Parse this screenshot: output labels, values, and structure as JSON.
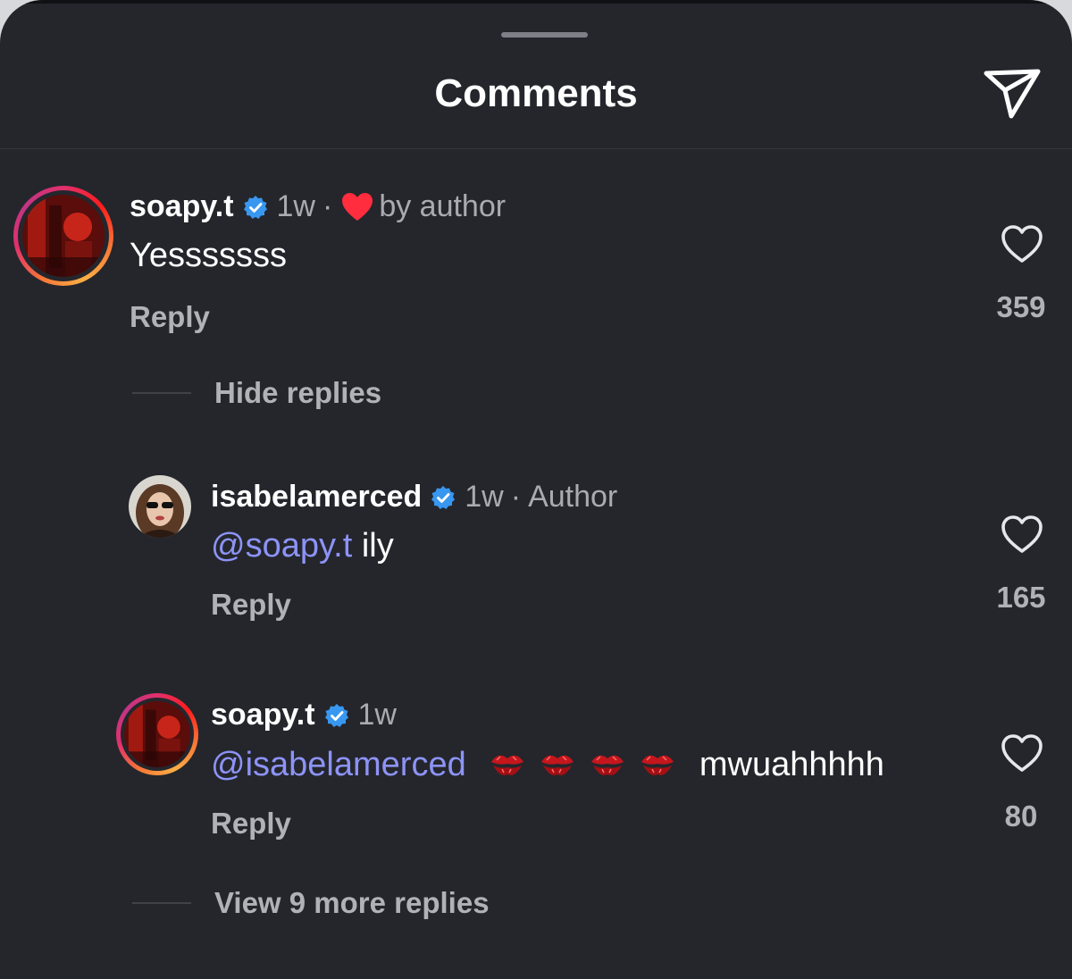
{
  "header": {
    "title": "Comments"
  },
  "colors": {
    "background": "#24262c",
    "text": "#ffffff",
    "secondary_text": "#a9abb1",
    "mention": "#8d93f6",
    "verified": "#3897f0",
    "liked_heart": "#ff2d3d"
  },
  "comments": [
    {
      "username": "soapy.t",
      "verified": true,
      "time": "1w",
      "separator": "·",
      "badge": "by author",
      "badge_icon": "red-heart-icon",
      "text": "Yesssssss",
      "reply_label": "Reply",
      "like_count": "359",
      "toggle_label": "Hide replies"
    },
    {
      "username": "isabelamerced",
      "verified": true,
      "time": "1w",
      "separator": "·",
      "badge": "Author",
      "mention": "@soapy.t",
      "text": "ily",
      "reply_label": "Reply",
      "like_count": "165"
    },
    {
      "username": "soapy.t",
      "verified": true,
      "time": "1w",
      "mention": "@isabelamerced",
      "emoji": "💋💋💋💋",
      "text": "mwuahhhhh",
      "reply_label": "Reply",
      "like_count": "80",
      "toggle_label": "View 9 more replies"
    }
  ]
}
